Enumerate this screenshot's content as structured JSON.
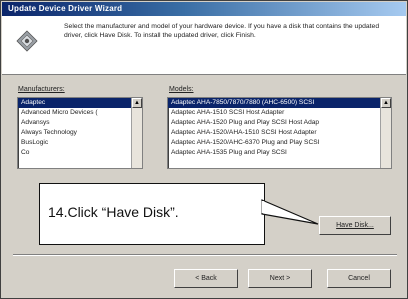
{
  "window": {
    "title": "Update Device Driver Wizard"
  },
  "header": {
    "instruction": "Select the manufacturer and model of your hardware device. If you have a disk that contains the updated driver, click Have Disk. To install the updated driver, click Finish."
  },
  "manufacturers": {
    "label": "Manufacturers:",
    "items": [
      "Adaptec",
      "Advanced Micro Devices (",
      "Advansys",
      "Always Technology",
      "BusLogic",
      "Co"
    ],
    "selected_index": 0
  },
  "models": {
    "label": "Models:",
    "items": [
      "Adaptec AHA-7850/7870/7880 (AHC-6500) SCSI",
      "Adaptec AHA-1510 SCSI Host Adapter",
      "Adaptec AHA-1520 Plug and Play SCSI Host Adap",
      "Adaptec AHA-1520/AHA-1510 SCSI Host Adapter",
      "Adaptec AHA-1520/AHC-6370 Plug and Play SCSI",
      "Adaptec AHA-1535 Plug and Play SCSI"
    ],
    "selected_index": 0
  },
  "buttons": {
    "have_disk": "Have Disk...",
    "back": "< Back",
    "next": "Next >",
    "cancel": "Cancel"
  },
  "callout": {
    "text": "14.Click “Have Disk”."
  },
  "colors": {
    "dialog_face": "#d4d0c8",
    "selection": "#0a246a",
    "title_start": "#0a246a",
    "title_end": "#a6caf0"
  }
}
